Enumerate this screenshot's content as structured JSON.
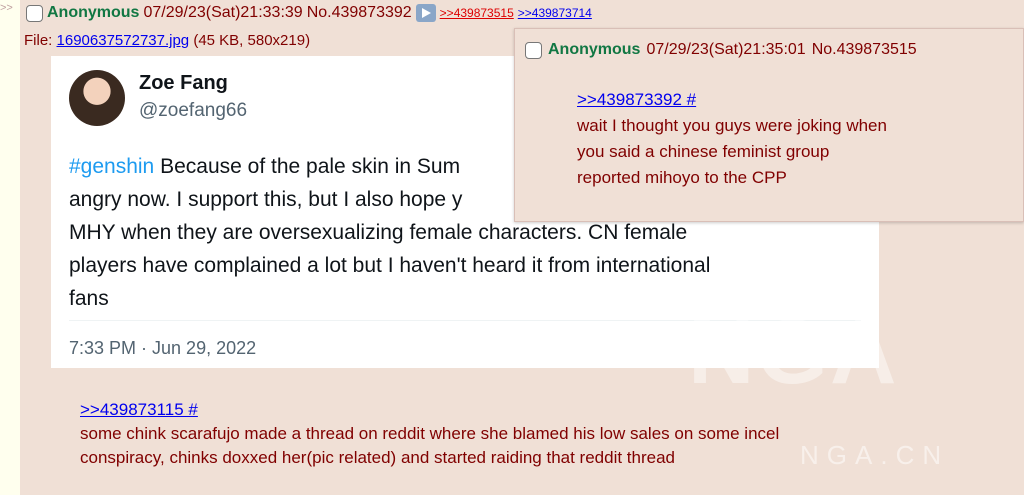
{
  "post": {
    "name": "Anonymous",
    "datetime": "07/29/23(Sat)21:33:39",
    "number": "No.439873392",
    "backlinks": [
      ">>439873515",
      ">>439873714"
    ],
    "file": {
      "label": "File:",
      "filename": "1690637572737.jpg",
      "meta": "(45 KB, 580x219)"
    },
    "comment_quote": ">>439873115 #",
    "comment_lines": [
      "some chink scarafujo made a thread on reddit where she blamed his low sales on some incel",
      "conspiracy, chinks doxxed her(pic related) and started raiding that reddit thread"
    ]
  },
  "sidebar": {
    "arrows": ">>"
  },
  "tweet": {
    "display_name": "Zoe Fang",
    "handle": "@zoefang66",
    "hashtag": "#genshin",
    "lines": [
      " Because of the pale skin in Sum",
      "angry now. I support this, but I also hope y",
      "MHY when they are oversexualizing female characters. CN female",
      "players have complained a lot but I haven't heard it from international",
      "fans"
    ],
    "timestamp": "7:33 PM · Jun 29, 2022"
  },
  "watermark": {
    "big": "NGA",
    "small": "NGA.CN"
  },
  "reply_preview": {
    "name": "Anonymous",
    "datetime": "07/29/23(Sat)21:35:01",
    "number": "No.439873515",
    "quote": ">>439873392 #",
    "lines": [
      "wait I thought you guys were joking when",
      "you said a chinese feminist group",
      "reported mihoyo to the CPP"
    ]
  },
  "colors": {
    "post_bg": "#f0e0d6",
    "name": "#117743",
    "text": "#800000",
    "link": "#0000ee",
    "backlink_hover": "#dd0000",
    "hashtag": "#1d9bf0"
  }
}
